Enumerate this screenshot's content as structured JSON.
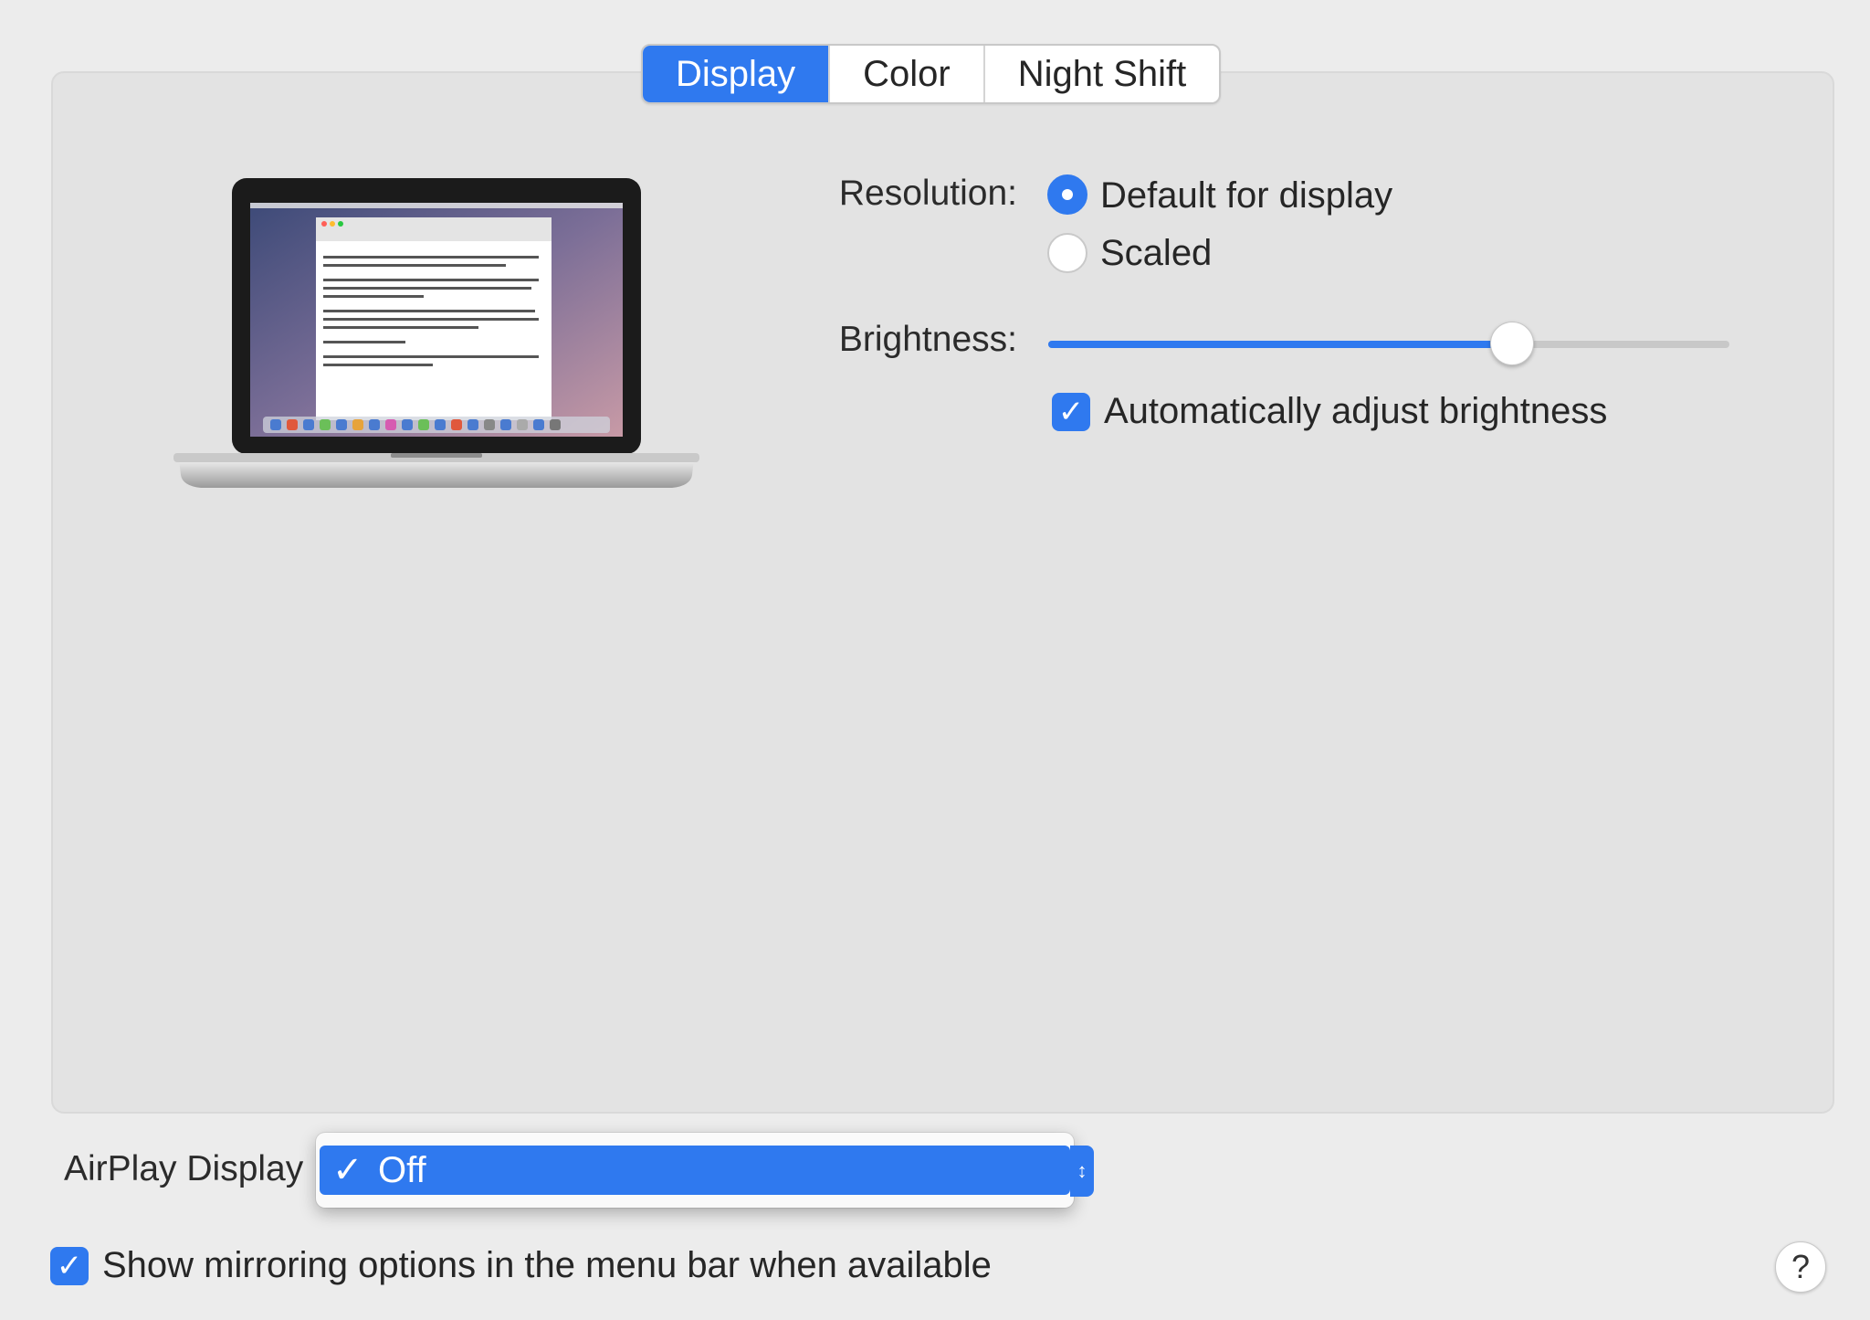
{
  "tabs": [
    "Display",
    "Color",
    "Night Shift"
  ],
  "active_tab": "Display",
  "resolution": {
    "label": "Resolution:",
    "options": [
      "Default for display",
      "Scaled"
    ],
    "selected": "Default for display"
  },
  "brightness": {
    "label": "Brightness:",
    "level": 0.68,
    "auto_label": "Automatically adjust brightness",
    "auto_checked": true
  },
  "airplay": {
    "label": "AirPlay Display",
    "value": "Off",
    "check_glyph": "✓"
  },
  "mirroring": {
    "label": "Show mirroring options in the menu bar when available",
    "checked": true
  },
  "help": "?",
  "icons": [
    "laptop-preview-icon",
    "check-icon",
    "popup-arrows-icon",
    "help-icon"
  ],
  "colors": {
    "accent": "#2f79ef",
    "background": "#ececec",
    "panel": "#e3e3e3"
  }
}
